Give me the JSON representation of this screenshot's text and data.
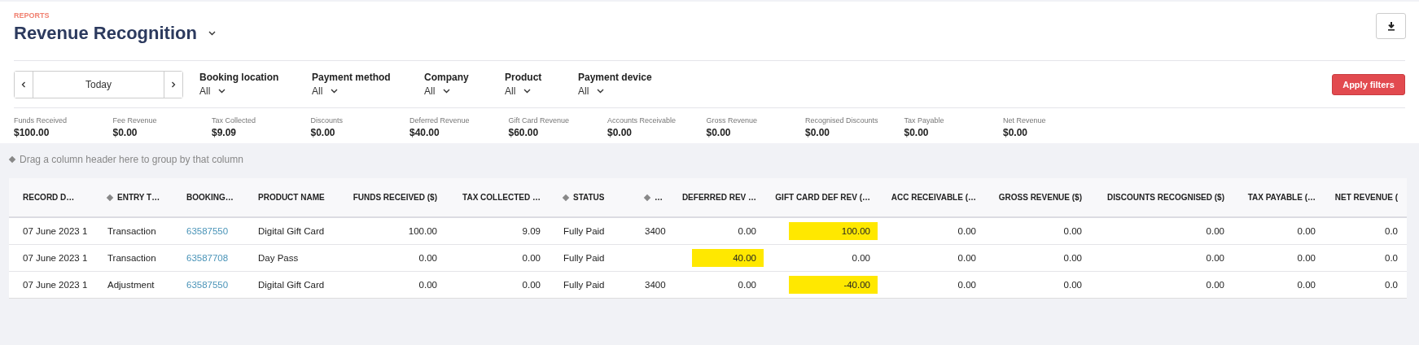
{
  "header": {
    "eyebrow": "REPORTS",
    "title": "Revenue Recognition"
  },
  "date_range": {
    "value": "Today"
  },
  "filters": [
    {
      "label": "Booking location",
      "value": "All"
    },
    {
      "label": "Payment method",
      "value": "All"
    },
    {
      "label": "Company",
      "value": "All"
    },
    {
      "label": "Product",
      "value": "All"
    },
    {
      "label": "Payment device",
      "value": "All"
    }
  ],
  "apply_button": "Apply filters",
  "metrics": [
    {
      "label": "Funds Received",
      "value": "$100.00"
    },
    {
      "label": "Fee Revenue",
      "value": "$0.00"
    },
    {
      "label": "Tax Collected",
      "value": "$9.09"
    },
    {
      "label": "Discounts",
      "value": "$0.00"
    },
    {
      "label": "Deferred Revenue",
      "value": "$40.00"
    },
    {
      "label": "Gift Card Revenue",
      "value": "$60.00"
    },
    {
      "label": "Accounts Receivable",
      "value": "$0.00"
    },
    {
      "label": "Gross Revenue",
      "value": "$0.00"
    },
    {
      "label": "Recognised Discounts",
      "value": "$0.00"
    },
    {
      "label": "Tax Payable",
      "value": "$0.00"
    },
    {
      "label": "Net Revenue",
      "value": "$0.00"
    }
  ],
  "group_hint": "Drag a column header here to group by that column",
  "table": {
    "columns": [
      {
        "label": "RECORD D…",
        "grouped": false
      },
      {
        "label": "ENTRY T…",
        "grouped": true
      },
      {
        "label": "BOOKING…",
        "grouped": false
      },
      {
        "label": "PRODUCT NAME",
        "grouped": false
      },
      {
        "label": "FUNDS RECEIVED ($)",
        "grouped": false
      },
      {
        "label": "TAX COLLECTED …",
        "grouped": false
      },
      {
        "label": "STATUS",
        "grouped": true
      },
      {
        "label": "…",
        "grouped": true
      },
      {
        "label": "DEFERRED REV …",
        "grouped": false
      },
      {
        "label": "GIFT CARD DEF REV (…",
        "grouped": false
      },
      {
        "label": "ACC RECEIVABLE (…",
        "grouped": false
      },
      {
        "label": "GROSS REVENUE ($)",
        "grouped": false
      },
      {
        "label": "DISCOUNTS RECOGNISED ($)",
        "grouped": false
      },
      {
        "label": "TAX PAYABLE (…",
        "grouped": false
      },
      {
        "label": "NET REVENUE (",
        "grouped": false
      }
    ],
    "rows": [
      {
        "cells": [
          {
            "text": "07 June 2023 1",
            "highlighted": false
          },
          {
            "text": "Transaction",
            "highlighted": false
          },
          {
            "text": "63587550",
            "highlighted": false,
            "kind": "link"
          },
          {
            "text": "Digital Gift Card",
            "highlighted": false
          },
          {
            "text": "100.00",
            "highlighted": false
          },
          {
            "text": "9.09",
            "highlighted": false
          },
          {
            "text": "Fully Paid",
            "highlighted": false
          },
          {
            "text": "3400",
            "highlighted": false
          },
          {
            "text": "0.00",
            "highlighted": false
          },
          {
            "text": "100.00",
            "highlighted": true
          },
          {
            "text": "0.00",
            "highlighted": false
          },
          {
            "text": "0.00",
            "highlighted": false
          },
          {
            "text": "0.00",
            "highlighted": false
          },
          {
            "text": "0.00",
            "highlighted": false
          },
          {
            "text": "0.0",
            "highlighted": false
          }
        ]
      },
      {
        "cells": [
          {
            "text": "07 June 2023 1",
            "highlighted": false
          },
          {
            "text": "Transaction",
            "highlighted": false
          },
          {
            "text": "63587708",
            "highlighted": false,
            "kind": "link"
          },
          {
            "text": "Day Pass",
            "highlighted": false
          },
          {
            "text": "0.00",
            "highlighted": false
          },
          {
            "text": "0.00",
            "highlighted": false
          },
          {
            "text": "Fully Paid",
            "highlighted": false
          },
          {
            "highlighted": false
          },
          {
            "text": "40.00",
            "highlighted": true
          },
          {
            "text": "0.00",
            "highlighted": false
          },
          {
            "text": "0.00",
            "highlighted": false
          },
          {
            "text": "0.00",
            "highlighted": false
          },
          {
            "text": "0.00",
            "highlighted": false
          },
          {
            "text": "0.00",
            "highlighted": false
          },
          {
            "text": "0.0",
            "highlighted": false
          }
        ]
      },
      {
        "cells": [
          {
            "text": "07 June 2023 1",
            "highlighted": false
          },
          {
            "text": "Adjustment",
            "highlighted": false
          },
          {
            "text": "63587550",
            "highlighted": false,
            "kind": "link"
          },
          {
            "text": "Digital Gift Card",
            "highlighted": false
          },
          {
            "text": "0.00",
            "highlighted": false
          },
          {
            "text": "0.00",
            "highlighted": false
          },
          {
            "text": "Fully Paid",
            "highlighted": false
          },
          {
            "text": "3400",
            "highlighted": false
          },
          {
            "text": "0.00",
            "highlighted": false
          },
          {
            "text": "-40.00",
            "highlighted": true
          },
          {
            "text": "0.00",
            "highlighted": false
          },
          {
            "text": "0.00",
            "highlighted": false
          },
          {
            "text": "0.00",
            "highlighted": false
          },
          {
            "text": "0.00",
            "highlighted": false
          },
          {
            "text": "0.0",
            "highlighted": false
          }
        ]
      }
    ]
  }
}
